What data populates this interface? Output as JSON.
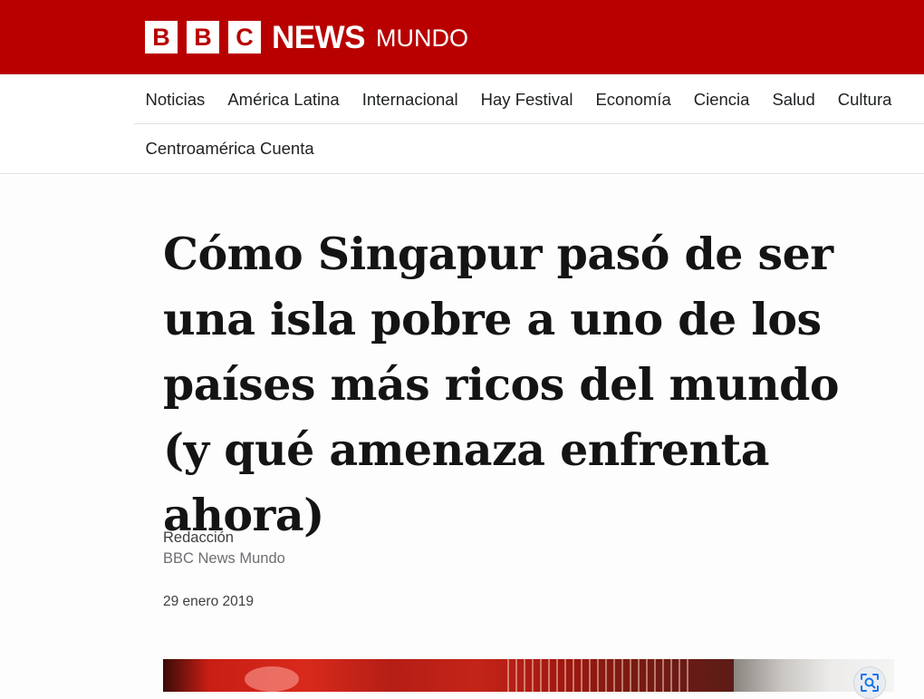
{
  "masthead": {
    "brand_letters": [
      "B",
      "B",
      "C"
    ],
    "brand_news": "NEWS",
    "brand_edition": "MUNDO",
    "background_color": "#b80000"
  },
  "nav": {
    "items": [
      {
        "label": "Noticias"
      },
      {
        "label": "América Latina"
      },
      {
        "label": "Internacional"
      },
      {
        "label": "Hay Festival"
      },
      {
        "label": "Economía"
      },
      {
        "label": "Ciencia"
      },
      {
        "label": "Salud"
      },
      {
        "label": "Cultura"
      }
    ],
    "second_row": [
      {
        "label": "Centroamérica Cuenta"
      }
    ]
  },
  "article": {
    "headline": "Cómo Singapur pasó de ser una isla pobre a uno de los países más ricos del mundo (y qué amenaza enfrenta ahora)",
    "byline_author": "Redacción",
    "byline_org": "BBC News Mundo",
    "date": "29 enero 2019"
  },
  "hero": {
    "zoom_icon": "image-search-icon"
  }
}
